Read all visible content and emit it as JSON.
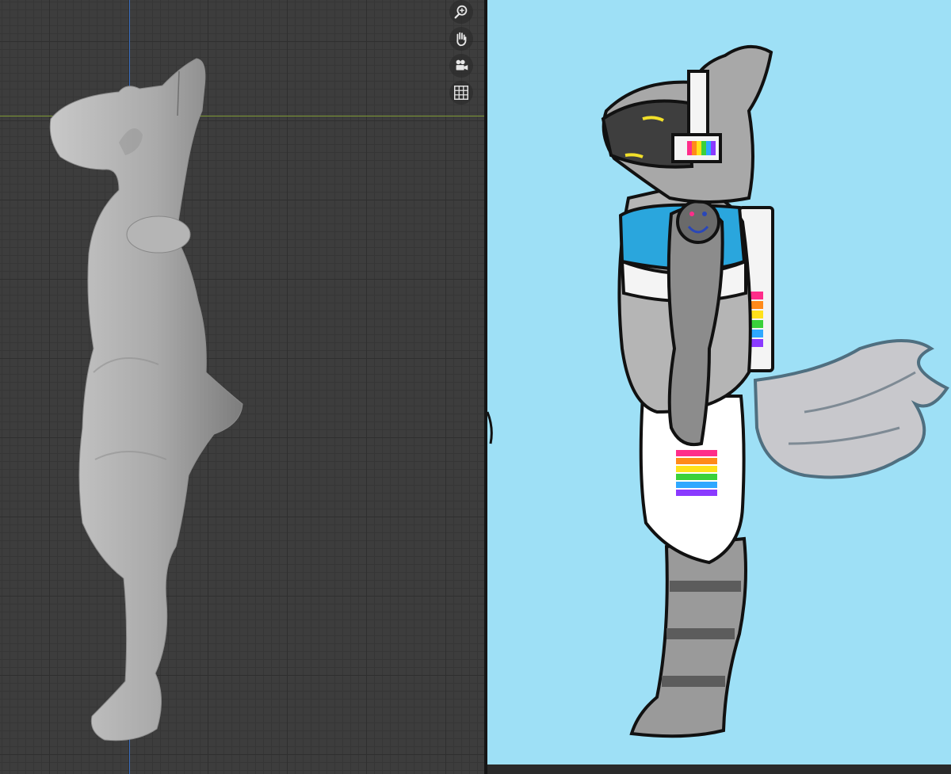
{
  "viewport": {
    "background": "#3d3d3d",
    "axis_x_color": "#7f9a35",
    "axis_z_color": "#3b6fc0",
    "nav_tools": [
      {
        "icon": "zoom-icon"
      },
      {
        "icon": "hand-pan-icon"
      },
      {
        "icon": "camera-icon"
      },
      {
        "icon": "grid-ortho-icon"
      }
    ],
    "model_color": "#a9a9a9"
  },
  "canvas": {
    "background": "#9ee0f6",
    "accent_blue": "#2aa6dd",
    "stripe_colors": [
      "#ff2d8a",
      "#ff8a1a",
      "#ffe11a",
      "#3ad13a",
      "#2ea8ff",
      "#8a3aff"
    ]
  }
}
